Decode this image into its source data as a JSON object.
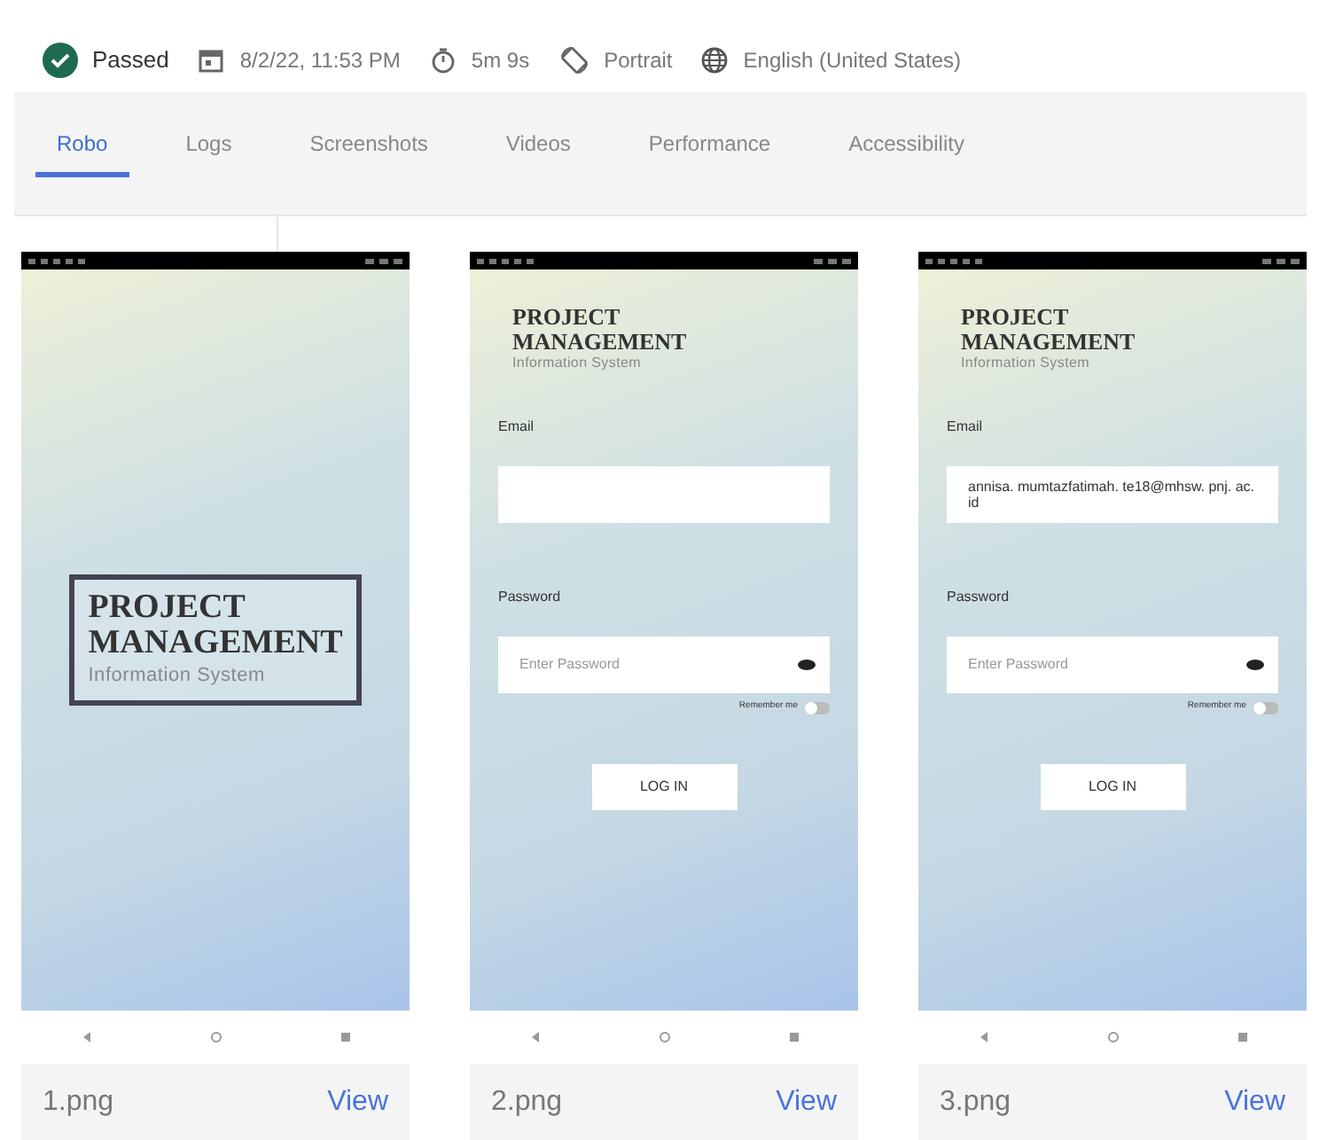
{
  "summary": {
    "outcome": {
      "label": "Passed",
      "kind": "passed"
    },
    "items": [
      {
        "kind": "calendar",
        "text": "8/2/22, 11:53 PM"
      },
      {
        "kind": "timer",
        "text": "5m 9s"
      },
      {
        "kind": "rotation",
        "text": "Portrait"
      },
      {
        "kind": "globe",
        "text": "English (United States)"
      }
    ]
  },
  "tabs": [
    {
      "label": "Robo",
      "selected": true
    },
    {
      "label": "Logs",
      "selected": false
    },
    {
      "label": "Screenshots",
      "selected": false
    },
    {
      "label": "Videos",
      "selected": false
    },
    {
      "label": "Performance",
      "selected": false
    },
    {
      "label": "Accessibility",
      "selected": false
    }
  ],
  "screenshots": [
    {
      "file": "1.png",
      "action": "View",
      "screen": {
        "kind": "splash",
        "logo": {
          "line1": "PROJECT",
          "line2": "MANAGEMENT",
          "line3": "Information System"
        }
      }
    },
    {
      "file": "2.png",
      "action": "View",
      "screen": {
        "kind": "login",
        "logo": {
          "line1": "PROJECT",
          "line2": "MANAGEMENT",
          "line3": "Information System"
        },
        "email_label": "Email",
        "password_label": "Password",
        "password_placeholder": "Enter Password",
        "remember_label": "Remember me",
        "remember_on": false,
        "button": "LOG IN"
      }
    },
    {
      "file": "3.png",
      "action": "View",
      "screen": {
        "kind": "login",
        "logo": {
          "line1": "PROJECT",
          "line2": "MANAGEMENT",
          "line3": "Information System"
        },
        "email_label": "Email",
        "email_value": "annisa. mumtazfatimah. te18@mhsw. pnj. ac. id",
        "password_label": "Password",
        "password_placeholder": "Enter Password",
        "remember_label": "Remember me",
        "remember_on": false,
        "button": "LOG IN"
      }
    }
  ]
}
